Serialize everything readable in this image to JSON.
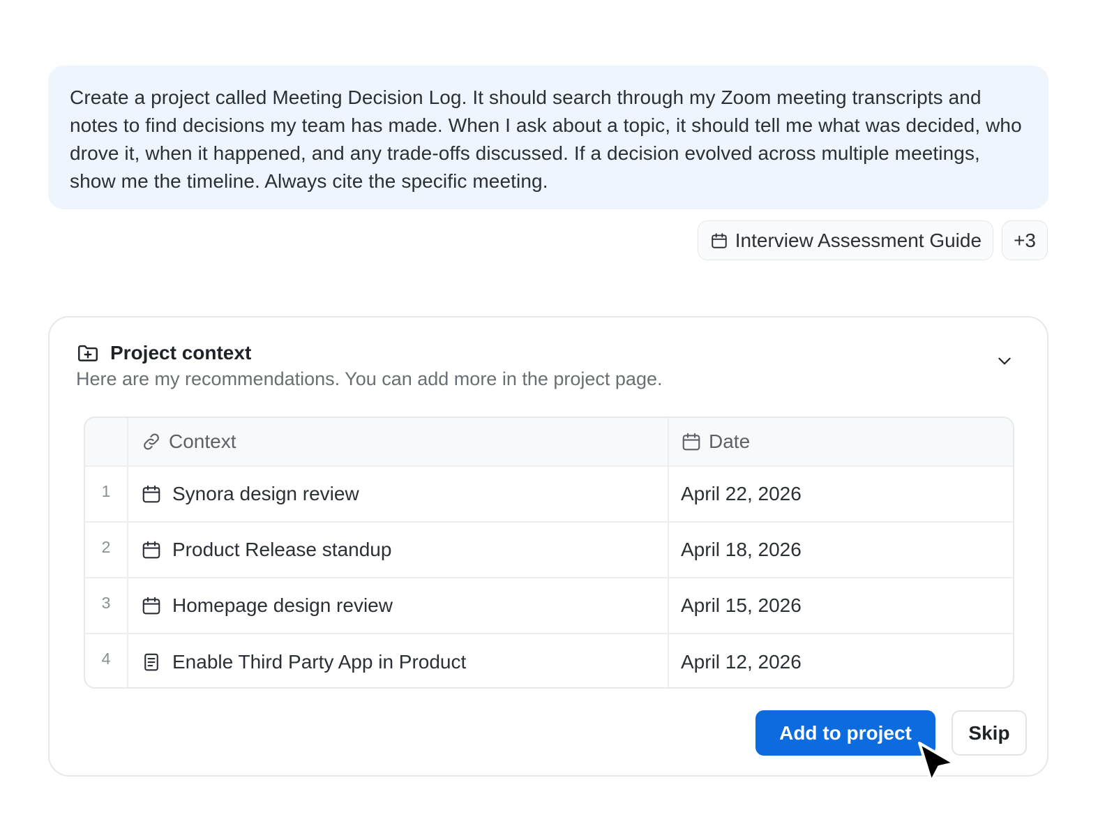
{
  "prompt": {
    "text": "Create a project called Meeting Decision Log. It should search through my Zoom meeting transcripts and notes to find decisions my team has made. When I ask about a topic, it should tell me what was decided, who drove it, when it happened, and any trade-offs discussed. If a decision evolved across multiple meetings, show me the timeline. Always cite the specific meeting."
  },
  "attachments": {
    "primary": {
      "label": "Interview Assessment Guide",
      "icon": "calendar-icon"
    },
    "more_label": "+3"
  },
  "project_context": {
    "title": "Project context",
    "icon": "folder-plus-icon",
    "subtitle": "Here are my recommendations. You can add more in the project page.",
    "table": {
      "columns": [
        {
          "label": "Context",
          "icon": "link-icon"
        },
        {
          "label": "Date",
          "icon": "calendar-icon"
        }
      ],
      "rows": [
        {
          "num": "1",
          "icon": "calendar-icon",
          "context": "Synora design review",
          "date": "April 22, 2026"
        },
        {
          "num": "2",
          "icon": "calendar-icon",
          "context": "Product Release standup",
          "date": "April 18, 2026"
        },
        {
          "num": "3",
          "icon": "calendar-icon",
          "context": "Homepage design review",
          "date": "April 15, 2026"
        },
        {
          "num": "4",
          "icon": "document-icon",
          "context": "Enable Third Party App in Product",
          "date": "April 12, 2026"
        }
      ]
    },
    "actions": {
      "primary_label": "Add to project",
      "secondary_label": "Skip"
    }
  },
  "colors": {
    "accent": "#0b6bdf",
    "bubble_bg": "#eff5fd",
    "border": "#e6e8eb"
  }
}
